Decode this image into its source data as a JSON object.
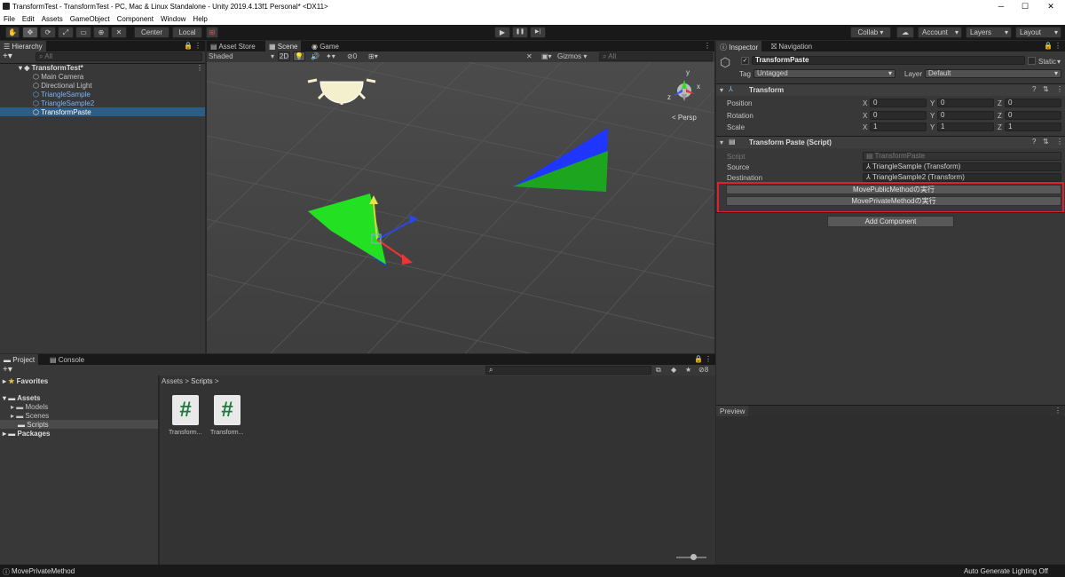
{
  "window": {
    "title": "TransformTest - TransformTest - PC, Mac & Linux Standalone - Unity 2019.4.13f1 Personal* <DX11>",
    "min": "─",
    "max": "☐",
    "close": "✕"
  },
  "menu": [
    "File",
    "Edit",
    "Assets",
    "GameObject",
    "Component",
    "Window",
    "Help"
  ],
  "toolbar": {
    "tools": [
      "✋",
      "✥",
      "⟳",
      "⤢",
      "▭",
      "⊕",
      "✕"
    ],
    "center": "Center",
    "local": "Local",
    "play": "▶",
    "pause": "❚❚",
    "step": "▶|",
    "collab": "Collab ▾",
    "cloud": "☁",
    "account": "Account",
    "layers": "Layers",
    "layout": "Layout"
  },
  "hierarchy": {
    "tab": "Hierarchy",
    "search": "All",
    "scene": "TransformTest*",
    "items": [
      "Main Camera",
      "Directional Light",
      "TriangleSample",
      "TriangleSample2",
      "TransformPaste"
    ]
  },
  "center_tabs": [
    "Asset Store",
    "Scene",
    "Game"
  ],
  "scene_toolbar": {
    "shading": "Shaded",
    "mode2d": "2D",
    "hidden": "0",
    "gizmos": "Gizmos",
    "search": "All",
    "persp": "< Persp"
  },
  "inspector": {
    "tabs": [
      "Inspector",
      "Navigation"
    ],
    "object_name": "TransformPaste",
    "static_label": "Static",
    "tag_label": "Tag",
    "tag_value": "Untagged",
    "layer_label": "Layer",
    "layer_value": "Default",
    "transform": {
      "title": "Transform",
      "rows": [
        {
          "label": "Position",
          "x": "0",
          "y": "0",
          "z": "0"
        },
        {
          "label": "Rotation",
          "x": "0",
          "y": "0",
          "z": "0"
        },
        {
          "label": "Scale",
          "x": "1",
          "y": "1",
          "z": "1"
        }
      ]
    },
    "script_comp": {
      "title": "Transform Paste (Script)",
      "script_label": "Script",
      "script_value": "TransformPaste",
      "source_label": "Source",
      "source_value": "TriangleSample (Transform)",
      "dest_label": "Destination",
      "dest_value": "TriangleSample2 (Transform)",
      "btn_public": "MovePublicMethodの実行",
      "btn_private": "MovePrivateMethodの実行"
    },
    "add_component": "Add Component",
    "preview": "Preview"
  },
  "project": {
    "tabs": [
      "Project",
      "Console"
    ],
    "favorites": "Favorites",
    "assets": "Assets",
    "folders": [
      "Models",
      "Scenes",
      "Scripts"
    ],
    "packages": "Packages",
    "breadcrumb": [
      "Assets",
      ">",
      "Scripts",
      ">"
    ],
    "files": [
      "Transform...",
      "Transform..."
    ],
    "hidden_count": "8"
  },
  "status": {
    "left": "MovePrivateMethod",
    "right": "Auto Generate Lighting Off"
  },
  "axis": {
    "x": "x",
    "y": "y",
    "z": "z"
  }
}
